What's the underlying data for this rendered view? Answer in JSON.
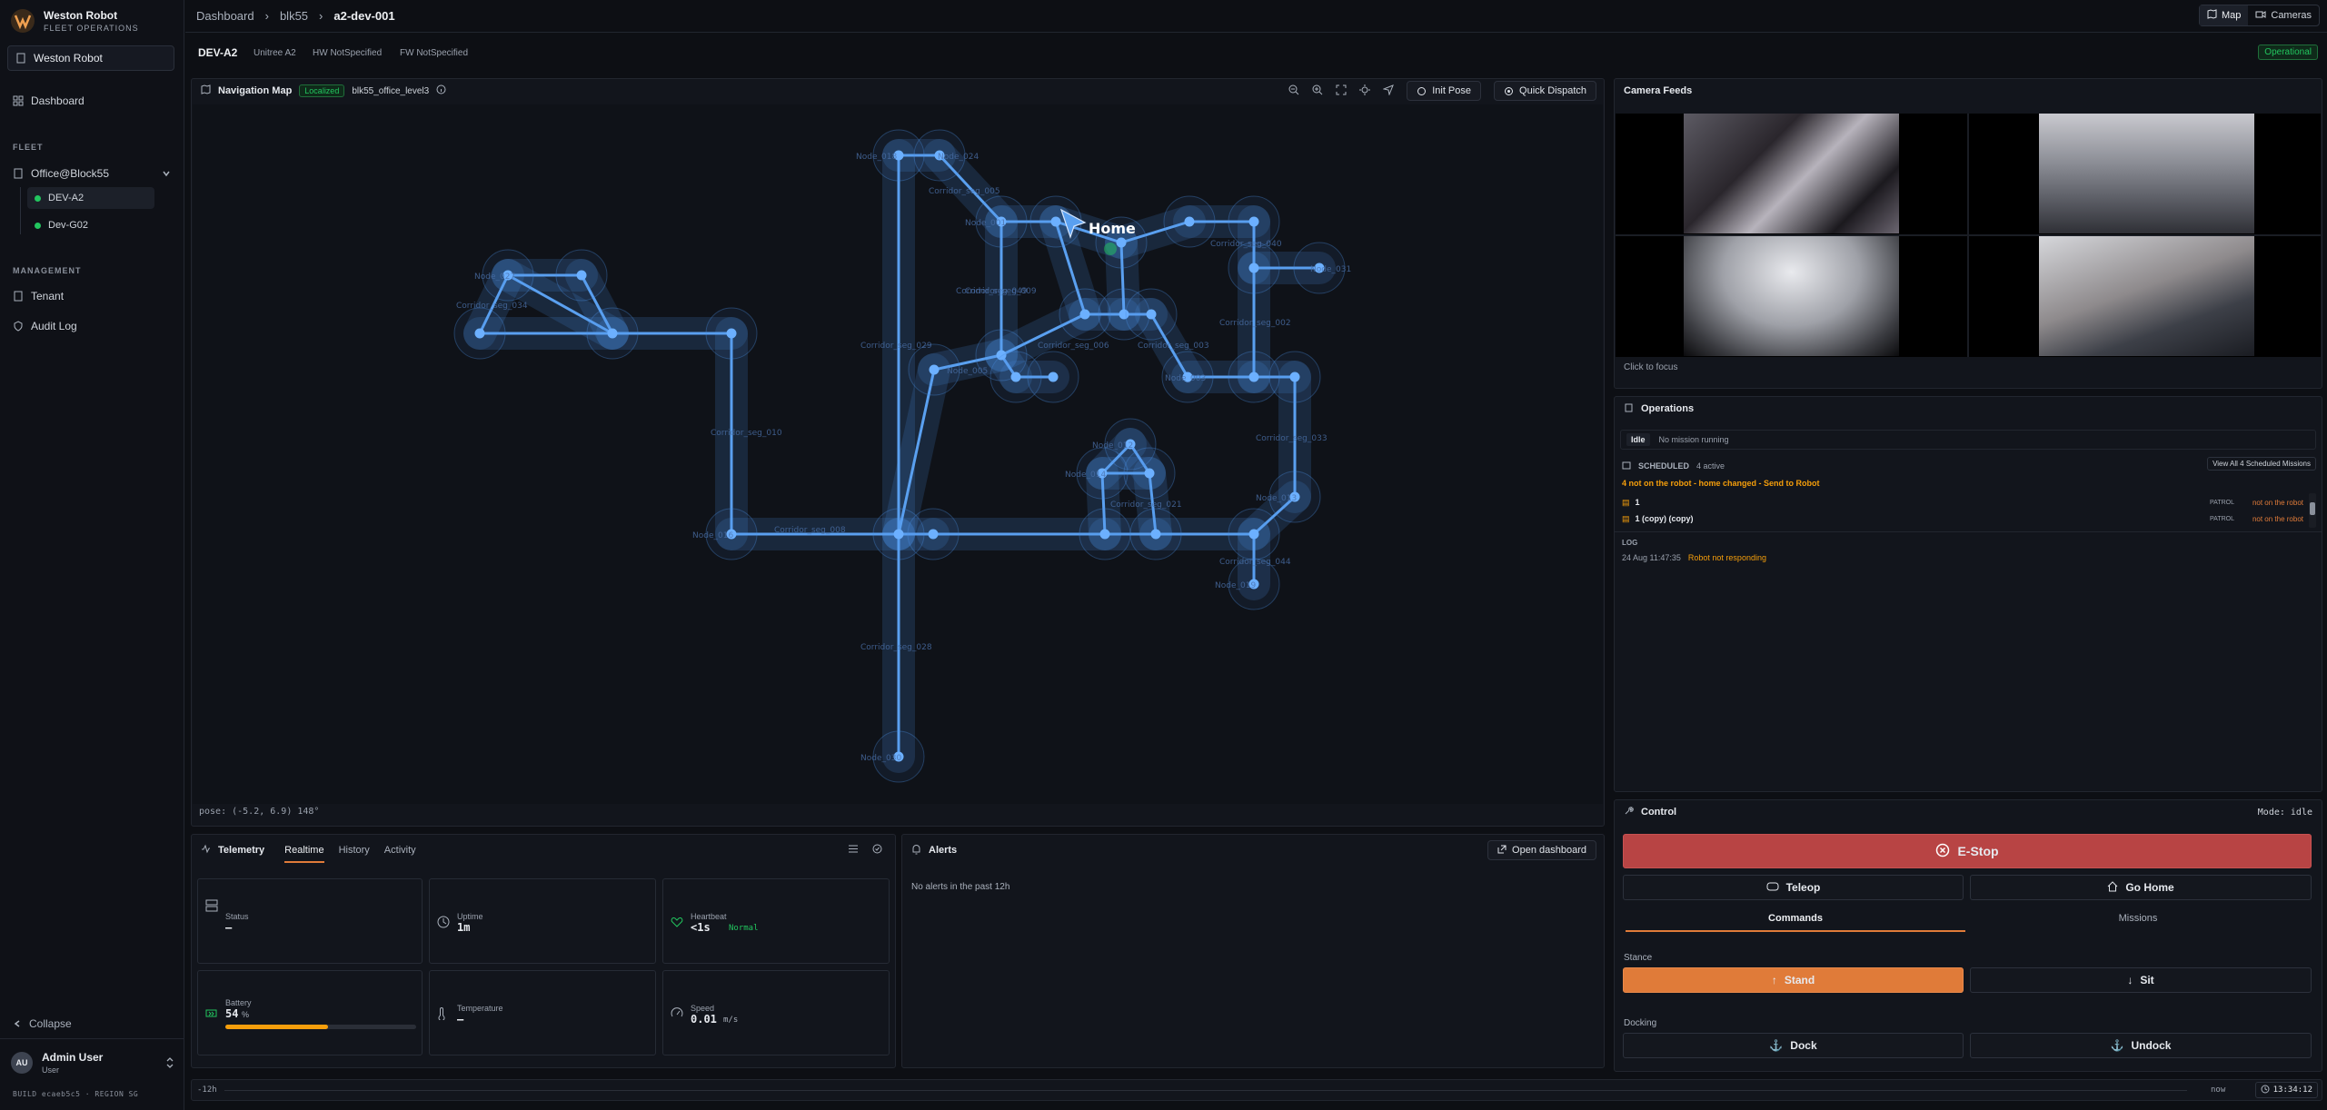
{
  "brand": {
    "name": "Weston Robot",
    "sub": "FLEET OPERATIONS",
    "tenant": "Weston Robot"
  },
  "sidebar": {
    "dashboard": "Dashboard",
    "fleet_section": "FLEET",
    "site": "Office@Block55",
    "robots": [
      {
        "name": "DEV-A2",
        "status_color": "#22c55e"
      },
      {
        "name": "Dev-G02",
        "status_color": "#22c55e"
      }
    ],
    "management_section": "MANAGEMENT",
    "tenant": "Tenant",
    "audit": "Audit Log",
    "collapse": "Collapse",
    "user_initials": "AU",
    "user_name": "Admin User",
    "user_role": "User",
    "build": "BUILD ecaeb5c5 · REGION SG"
  },
  "breadcrumb": [
    "Dashboard",
    "blk55",
    "a2-dev-001"
  ],
  "view_tabs": {
    "map": "Map",
    "cameras": "Cameras"
  },
  "robot": {
    "name": "DEV-A2",
    "model": "Unitree A2",
    "hw": "HW NotSpecified",
    "fw": "FW NotSpecified",
    "status": "Operational"
  },
  "map": {
    "title": "Navigation Map",
    "localized": "Localized",
    "map_name": "blk55_office_level3",
    "init_pose": "Init Pose",
    "quick_dispatch": "Quick Dispatch",
    "home_label": "Home",
    "pose": "pose: (-5.2, 6.9) 148°",
    "labels": [
      "Node_018",
      "Node_024",
      "Corridor_seg_005",
      "Node_001",
      "Node_031",
      "Corridor_seg_040",
      "Node_027",
      "Corridor_seg_034",
      "Corridor_seg_049",
      "Corridor_seg_009",
      "Corridor_seg_006",
      "Corridor_seg_002",
      "Corridor_seg_029",
      "Node_005",
      "Corridor_seg_003",
      "Node_003",
      "Corridor_seg_033",
      "Corridor_seg_010",
      "Node_012",
      "Node_014",
      "Corridor_seg_021",
      "Node_013",
      "Corridor_seg_008",
      "Node_016",
      "Corridor_seg_044",
      "Node_019",
      "Corridor_seg_028",
      "Node_030"
    ]
  },
  "cameras": {
    "title": "Camera Feeds",
    "hint": "Click to focus"
  },
  "operations": {
    "title": "Operations",
    "state": "Idle",
    "mission": "No mission running",
    "scheduled_label": "SCHEDULED",
    "active": "4 active",
    "view_all": "View All 4 Scheduled Missions",
    "warning": "4 not on the robot - home changed - Send to Robot",
    "missions": [
      {
        "name": "1",
        "type": "PATROL",
        "status": "not on the robot"
      },
      {
        "name": "1 (copy) (copy)",
        "type": "PATROL",
        "status": "not on the robot"
      }
    ],
    "log_label": "LOG",
    "log": [
      {
        "time": "24 Aug 11:47:35",
        "msg": "Robot not responding"
      }
    ]
  },
  "telemetry": {
    "title": "Telemetry",
    "tabs": [
      "Realtime",
      "History",
      "Activity"
    ],
    "status_label": "Status",
    "status": "–",
    "uptime_label": "Uptime",
    "uptime": "1m",
    "heartbeat_label": "Heartbeat",
    "heartbeat": "<1s",
    "heartbeat_state": "Normal",
    "battery_label": "Battery",
    "battery": "54",
    "battery_unit": "%",
    "battery_level": 0.54,
    "temp_label": "Temperature",
    "temp": "–",
    "speed_label": "Speed",
    "speed": "0.01",
    "speed_unit": "m/s"
  },
  "alerts": {
    "title": "Alerts",
    "open": "Open dashboard",
    "empty": "No alerts in the past 12h"
  },
  "control": {
    "title": "Control",
    "mode": "Mode: idle",
    "estop": "E-Stop",
    "teleop": "Teleop",
    "gohome": "Go Home",
    "tabs": [
      "Commands",
      "Missions"
    ],
    "stance": "Stance",
    "stand": "Stand",
    "sit": "Sit",
    "docking": "Docking",
    "dock": "Dock",
    "undock": "Undock"
  },
  "timeline": {
    "start": "-12h",
    "end": "now",
    "time": "13:34:12"
  },
  "colors": {
    "accent": "#e07b39",
    "estop": "#b84444",
    "ok": "#22c55e",
    "map_line": "#4a90e2",
    "warn": "#f59e0b"
  }
}
